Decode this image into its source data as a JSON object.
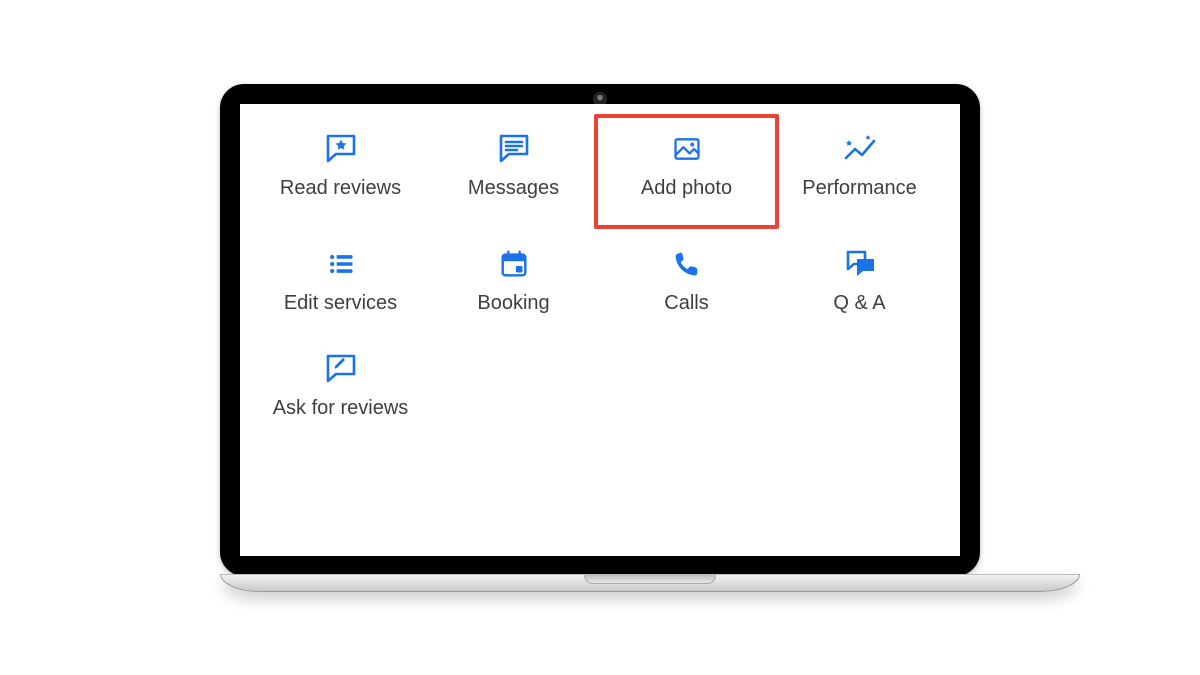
{
  "colors": {
    "accent": "#1a73e8",
    "highlight": "#ea4335",
    "text": "#3c4043"
  },
  "highlighted_tile": "add-photo",
  "tiles": {
    "read_reviews": {
      "label": "Read reviews"
    },
    "messages": {
      "label": "Messages"
    },
    "add_photo": {
      "label": "Add photo"
    },
    "performance": {
      "label": "Performance"
    },
    "edit_services": {
      "label": "Edit services"
    },
    "booking": {
      "label": "Booking"
    },
    "calls": {
      "label": "Calls"
    },
    "qa": {
      "label": "Q & A"
    },
    "ask_reviews": {
      "label": "Ask for reviews"
    }
  }
}
